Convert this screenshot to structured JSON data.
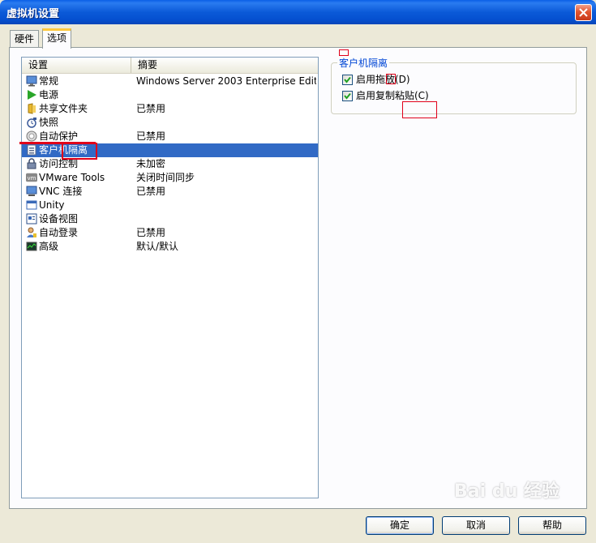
{
  "window": {
    "title": "虚拟机设置"
  },
  "tabs": [
    {
      "label": "硬件"
    },
    {
      "label": "选项"
    }
  ],
  "list": {
    "headers": [
      "设置",
      "摘要"
    ],
    "rows": [
      {
        "name": "常规",
        "summary": "Windows Server 2003 Enterprise Edit...",
        "icon": "monitor-icon"
      },
      {
        "name": "电源",
        "summary": "",
        "icon": "play-icon"
      },
      {
        "name": "共享文件夹",
        "summary": "已禁用",
        "icon": "folder-icon"
      },
      {
        "name": "快照",
        "summary": "",
        "icon": "snapshot-icon"
      },
      {
        "name": "自动保护",
        "summary": "已禁用",
        "icon": "shield-icon"
      },
      {
        "name": "客户机隔离",
        "summary": "",
        "icon": "isolation-icon"
      },
      {
        "name": "访问控制",
        "summary": "未加密",
        "icon": "lock-icon"
      },
      {
        "name": "VMware Tools",
        "summary": "关闭时间同步",
        "icon": "vmware-icon"
      },
      {
        "name": "VNC 连接",
        "summary": "已禁用",
        "icon": "vnc-icon"
      },
      {
        "name": "Unity",
        "summary": "",
        "icon": "unity-icon"
      },
      {
        "name": "设备视图",
        "summary": "",
        "icon": "device-view-icon"
      },
      {
        "name": "自动登录",
        "summary": "已禁用",
        "icon": "user-icon"
      },
      {
        "name": "高级",
        "summary": "默认/默认",
        "icon": "chart-icon"
      }
    ],
    "selected_index": 5
  },
  "group": {
    "title": "客户机隔离",
    "options": [
      {
        "label": "启用拖放(D)",
        "checked": true
      },
      {
        "label": "启用复制粘贴(C)",
        "checked": true
      }
    ]
  },
  "buttons": {
    "ok": "确定",
    "cancel": "取消",
    "help": "帮助"
  },
  "watermark": "Bai du 经验",
  "colors": {
    "selection": "#316AC5",
    "titlebar": "#0A5FE7",
    "annotation": "#E0001A"
  }
}
